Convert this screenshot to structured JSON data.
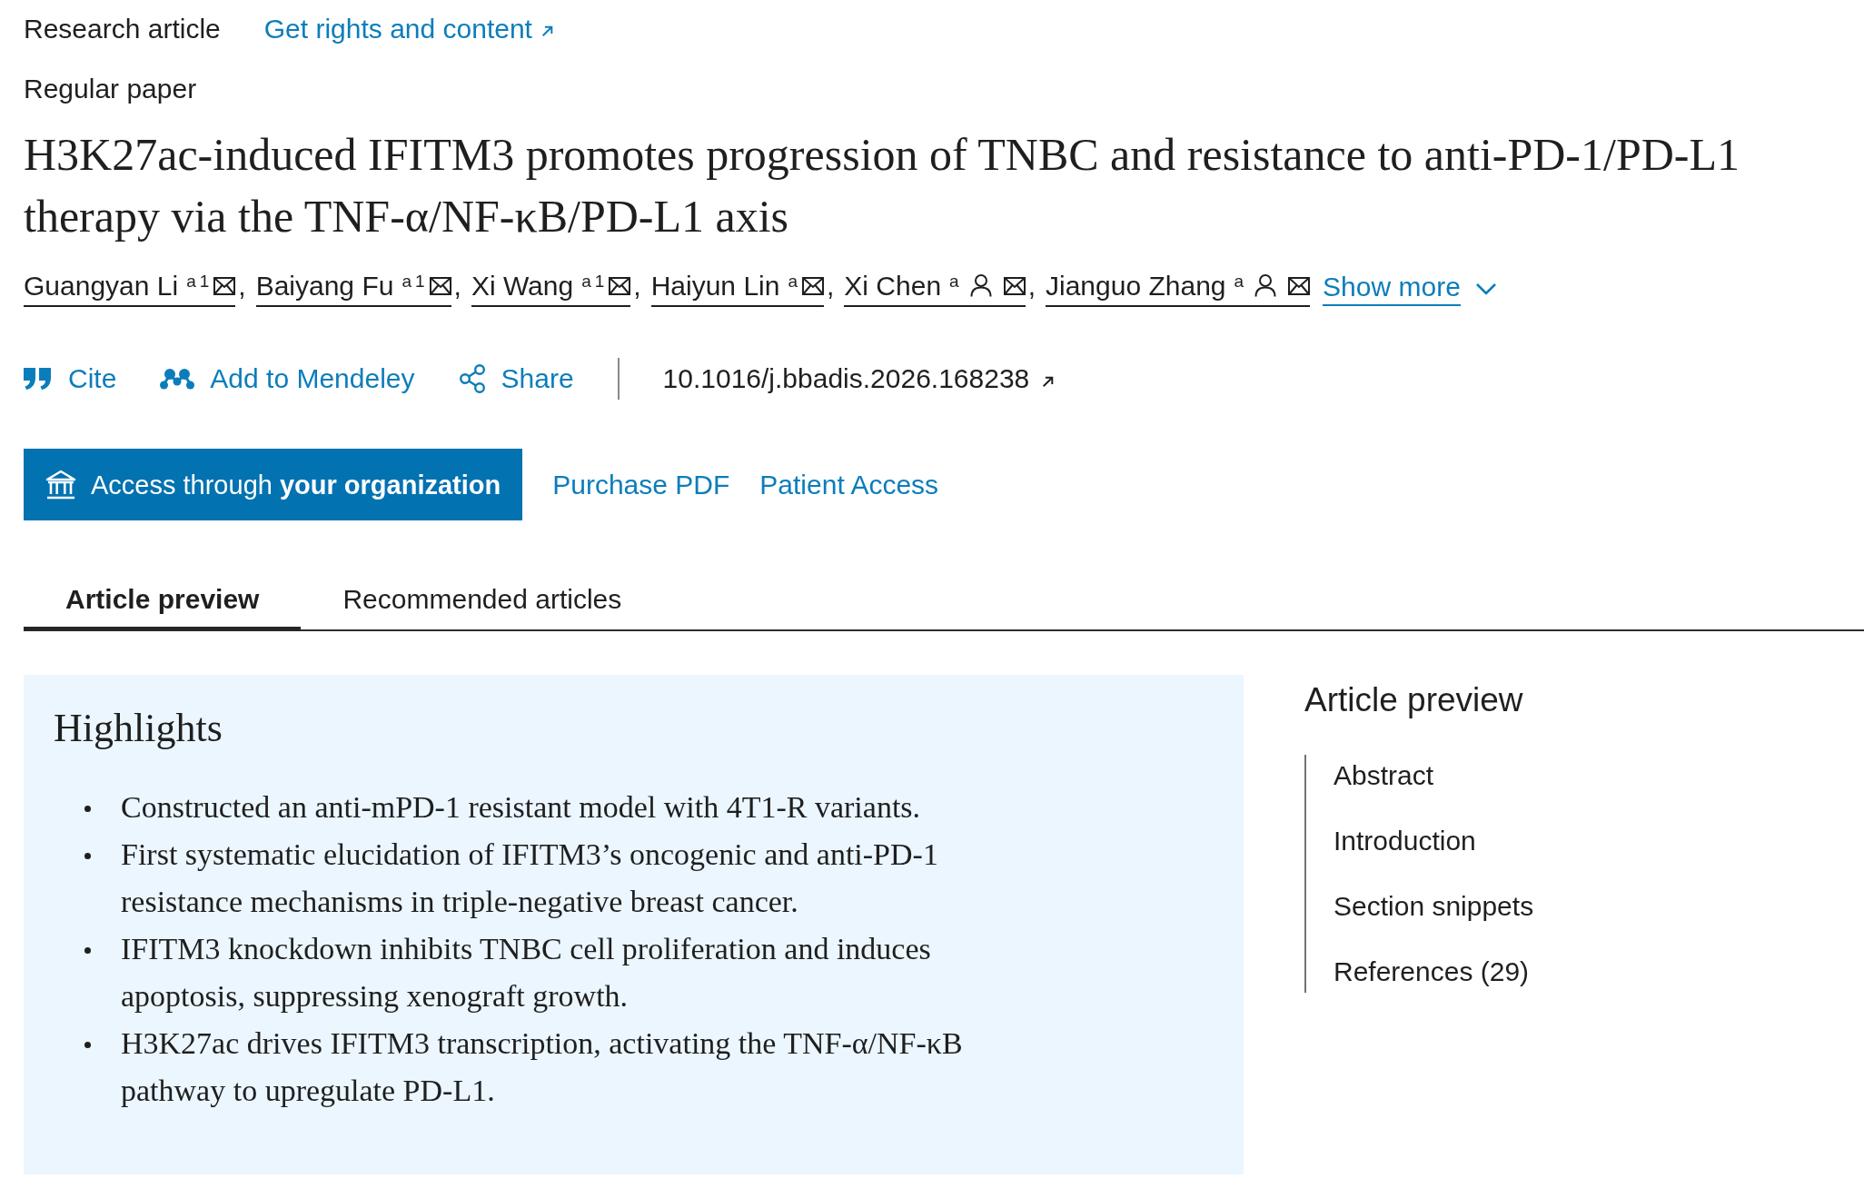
{
  "article_type": "Research article",
  "rights_link": "Get rights and content",
  "article_subtype": "Regular paper",
  "title": "H3K27ac-induced IFITM3 promotes progression of TNBC and resistance to anti-PD-1/PD-L1 therapy via the TNF-α/NF-κB/PD-L1 axis",
  "authors": [
    {
      "name": "Guangyan Li",
      "affiliations": [
        "a",
        "1"
      ],
      "corresponding": false
    },
    {
      "name": "Baiyang Fu",
      "affiliations": [
        "a",
        "1"
      ],
      "corresponding": false
    },
    {
      "name": "Xi Wang",
      "affiliations": [
        "a",
        "1"
      ],
      "corresponding": false
    },
    {
      "name": "Haiyun Lin",
      "affiliations": [
        "a"
      ],
      "corresponding": false
    },
    {
      "name": "Xi Chen",
      "affiliations": [
        "a"
      ],
      "corresponding": true
    },
    {
      "name": "Jianguo Zhang",
      "affiliations": [
        "a"
      ],
      "corresponding": true
    }
  ],
  "author_separator": ",",
  "show_more": "Show more",
  "actions": [
    {
      "kind": "cite",
      "label": "Cite"
    },
    {
      "kind": "library",
      "label": "Add to Mendeley"
    },
    {
      "kind": "share",
      "label": "Share"
    }
  ],
  "doi": "10.1016/j.bbadis.2026.168238",
  "access_button": "Access through **your organization**",
  "access_links": [
    "Purchase PDF",
    "Patient Access"
  ],
  "tabs": [
    {
      "label": "Article preview",
      "selected": true
    },
    {
      "label": "Recommended articles",
      "selected": false
    }
  ],
  "highlights": {
    "title": "Highlights",
    "items": [
      "Constructed an anti-mPD-1 resistant model with 4T1-R variants.",
      "First systematic elucidation of IFITM3’s oncogenic and anti-PD-1 resistance mechanisms in triple-negative breast cancer.",
      "IFITM3 knockdown inhibits TNBC cell proliferation and induces apoptosis, suppressing xenograft growth.",
      "H3K27ac drives IFITM3 transcription, activating the TNF-α/NF-κB pathway to upregulate PD-L1."
    ]
  },
  "outline": {
    "title": "Article preview",
    "items": [
      "Abstract",
      "Introduction",
      "Section snippets",
      "References (29)"
    ]
  }
}
